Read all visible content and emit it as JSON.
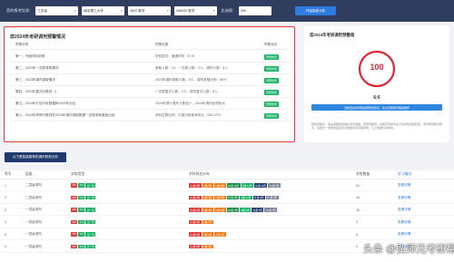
{
  "topbar": {
    "region_label": "您的报考信息:",
    "province": "江苏省",
    "school": "南京理工大学",
    "major_code": "0832 数学",
    "major_name": "085000 数学",
    "score_label": "总成绩:",
    "score_value": "350",
    "analyze_label": "开始智能分析"
  },
  "prediction": {
    "title": "您2024年考研调剂预警情况",
    "headers": [
      "预警说明",
      "预警结果",
      "预警状态"
    ],
    "rows": [
      {
        "item": "第一，书面材料说明",
        "result": "学校层次：普通学校（0~5）",
        "status": "预警较低"
      },
      {
        "item": "第二，2023年一志愿录取情况",
        "result": "录取人数：10，一志愿人数：2人，调剂人数：8人",
        "status": "预警较低"
      },
      {
        "item": "第三，2023年调剂录取情况",
        "result": "2023年调剂录取人数：8人，调剂录取比例：80%",
        "status": "预警较低"
      },
      {
        "item": "第四，2023年复试分数线（）",
        "result": "一志愿复试人数：2人，调剂复试人数：8人",
        "status": "预警较低"
      },
      {
        "item": "第五，2024年扩招分析数据和2023年对比",
        "result": "2024年预计调剂人数较少，2024年调剂比例较大",
        "status": "预警较低"
      },
      {
        "item": "第六，2024年考研分数线在2023年调剂录取数据一志愿录取差距比较",
        "result": "本科生群比例，中高分段竞争较大（350-370）",
        "status": "预警较低"
      }
    ]
  },
  "gauge_panel": {
    "title": "您2024年考研调剂预警值",
    "score": "100",
    "ratio": "6:6",
    "action_label": "当前您的调剂院校预警值较高，建议查看调剂院校推荐",
    "note": "预警值越高，越是需要提前做好调剂准备。预警值越低，说明该院校专业与您的情况越匹配，调剂概率相对越高。请结合一志愿成绩及复试准备情况合理安排，以上数据仅供参考。"
  },
  "recommend_button": "以下是智能推荐的调剂院校分析",
  "table": {
    "headers": [
      "序号",
      "层级",
      "学校类型",
      "学科排名分布",
      "学校数量",
      "学习情况"
    ],
    "rows": [
      {
        "idx": "1",
        "level": "二层级调剂",
        "tags": [
          "985",
          "211",
          "双一流"
        ],
        "dist": [
          "A+级 3所",
          "A级 5所",
          "A-级 9所",
          "B+级 11所",
          "B级 14所",
          "B-级 11所",
          "C+级 9所"
        ],
        "count": "62",
        "info": "查看详情"
      },
      {
        "idx": "2",
        "level": "二层级调剂",
        "tags": [
          "985",
          "211",
          "双一流"
        ],
        "dist": [
          "A+级 2所",
          "A级 4所",
          "A-级 6所",
          "B+级 8所",
          "B级 10所",
          "B-级 8所",
          "C+级 6所"
        ],
        "count": "44",
        "info": "查看详情"
      },
      {
        "idx": "3",
        "level": "一层级调剂",
        "tags": [
          "985",
          "211",
          "双一流"
        ],
        "dist": [
          "A+级 1所",
          "A级 3所",
          "A-级 5所",
          "B+级 7所",
          "B级 9所",
          "B-级 7所",
          "C+级 4所"
        ],
        "count": "36",
        "info": "查看详情"
      },
      {
        "idx": "4",
        "level": "一层级调剂",
        "tags": [
          "985",
          "211",
          "双一流"
        ],
        "dist": [
          "A+级 1所",
          "A级 2所"
        ],
        "count": "3",
        "info": "查看详情"
      },
      {
        "idx": "5",
        "level": "一层级调剂",
        "tags": [
          "985",
          "211",
          "双一流"
        ],
        "dist": [
          "A+级 1所",
          "A级 2所",
          "A-级 3所"
        ],
        "count": "6",
        "info": "查看详情"
      },
      {
        "idx": "6",
        "level": "一层级调剂",
        "tags": [
          "985",
          "211",
          "双一流"
        ],
        "dist": [
          "A+级 2所",
          "A级 3所"
        ],
        "count": "5",
        "info": "查看详情"
      }
    ]
  },
  "watermark": "头条 @弘师兄考研帮",
  "colors": {
    "topbar_bg": "#2f3e5f",
    "accent_blue": "#2f7ce0",
    "alert_red": "#e03c3c",
    "status_green": "#1bb265"
  }
}
